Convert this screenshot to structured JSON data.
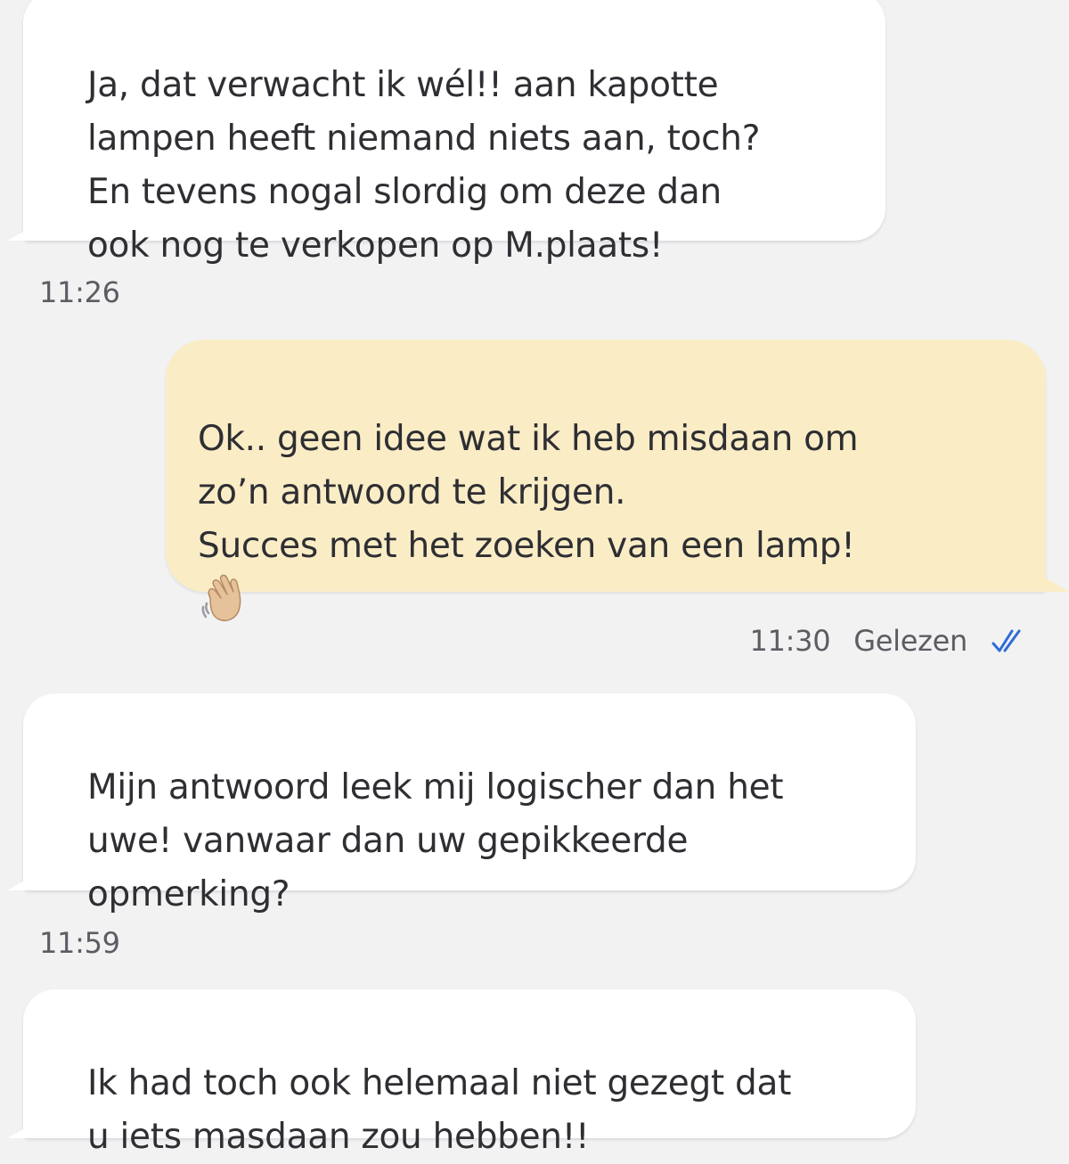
{
  "messages": [
    {
      "direction": "incoming",
      "text": "Ja, dat verwacht ik wél!! aan kapotte\nlampen heeft niemand niets aan, toch?\nEn tevens nogal slordig om deze dan\nook nog te verkopen op M.plaats!",
      "time": "11:26"
    },
    {
      "direction": "outgoing",
      "text": "Ok.. geen idee wat ik heb misdaan om\nzo’n antwoord te krijgen.\nSucces met het zoeken van een lamp!",
      "emoji": "waving-hand-icon",
      "time": "11:30",
      "status": "Gelezen"
    },
    {
      "direction": "incoming",
      "text": "Mijn antwoord leek mij logischer dan het\nuwe! vanwaar dan uw gepikkeerde\nopmerking?",
      "time": "11:59"
    },
    {
      "direction": "incoming",
      "text": "Ik had toch ook helemaal niet gezegt dat\nu iets masdaan zou hebben!!"
    }
  ],
  "colors": {
    "background": "#f2f2f3",
    "incoming_bubble": "#ffffff",
    "outgoing_bubble": "#faedc6",
    "read_check": "#2f6bd6"
  }
}
